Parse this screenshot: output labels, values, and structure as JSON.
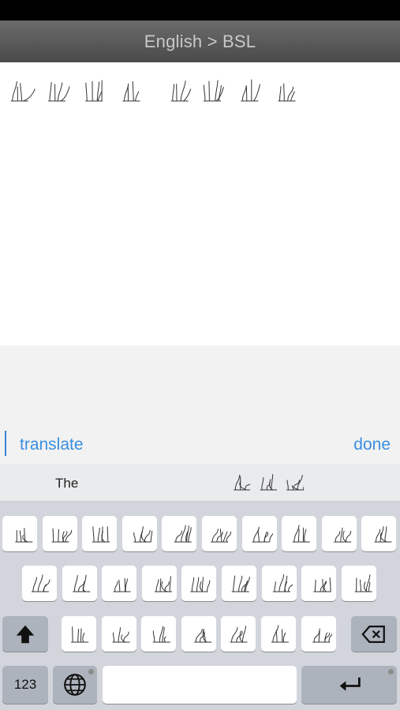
{
  "nav": {
    "title": "English > BSL"
  },
  "input": {
    "translate_label": "translate",
    "done_label": "done"
  },
  "suggestions": {
    "word": "The"
  },
  "keyboard": {
    "numbers_label": "123"
  },
  "colors": {
    "accent": "#3b8ee0",
    "nav_bg": "#555555",
    "keyboard_bg": "#d2d5db"
  },
  "icons": {
    "shift": "up-arrow-icon",
    "delete": "backspace-icon",
    "globe": "globe-icon",
    "return": "return-arrow-icon",
    "sign": "bsl-hand-sign-icon"
  }
}
